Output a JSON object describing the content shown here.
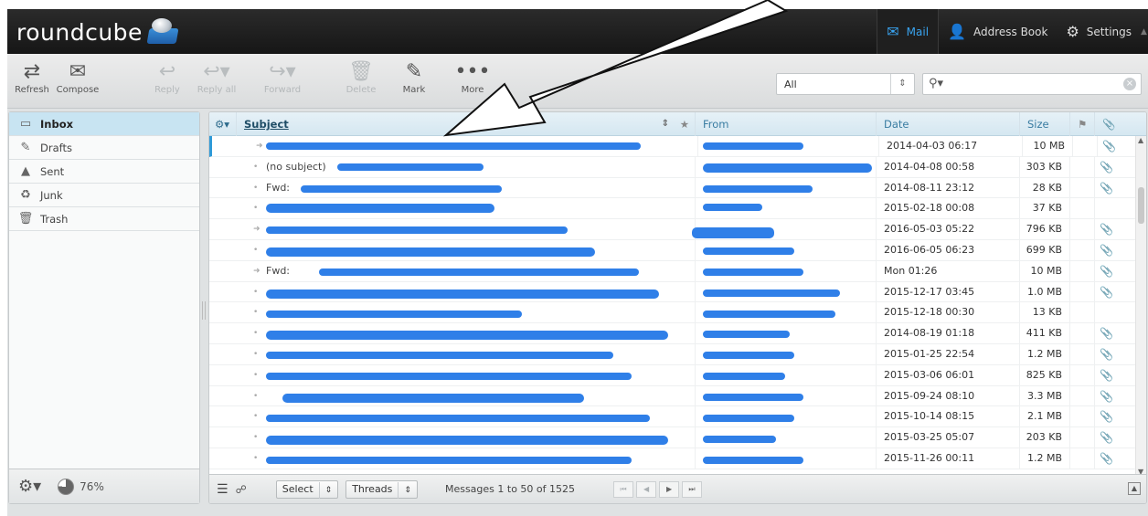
{
  "brand": {
    "name": "roundcube"
  },
  "topnav": [
    {
      "label": "Mail",
      "icon": "envelope-icon"
    },
    {
      "label": "Address Book",
      "icon": "person-icon"
    },
    {
      "label": "Settings",
      "icon": "gear-icon"
    }
  ],
  "toolbar": {
    "refresh": "Refresh",
    "compose": "Compose",
    "reply": "Reply",
    "reply_all": "Reply all",
    "forward": "Forward",
    "delete": "Delete",
    "mark": "Mark",
    "more": "More"
  },
  "filter": {
    "value": "All"
  },
  "search": {
    "placeholder": ""
  },
  "folders": [
    {
      "label": "Inbox",
      "icon": "inbox-icon",
      "active": true
    },
    {
      "label": "Drafts",
      "icon": "pencil-icon"
    },
    {
      "label": "Sent",
      "icon": "sent-icon"
    },
    {
      "label": "Junk",
      "icon": "junk-icon"
    },
    {
      "label": "Trash",
      "icon": "trash-icon"
    }
  ],
  "quota": {
    "label": "76%",
    "fraction": 0.76
  },
  "columns": {
    "subject": "Subject",
    "from": "From",
    "date": "Date",
    "size": "Size"
  },
  "messages": [
    {
      "subject": "",
      "from": "",
      "date": "2014-04-03 06:17",
      "size": "10 MB",
      "attachment": true
    },
    {
      "subject": "(no subject)",
      "from": "",
      "date": "2014-04-08 00:58",
      "size": "303 KB",
      "attachment": true
    },
    {
      "subject": "Fwd:",
      "from": "",
      "date": "2014-08-11 23:12",
      "size": "28 KB",
      "attachment": true
    },
    {
      "subject": "",
      "from": "",
      "date": "2015-02-18 00:08",
      "size": "37 KB",
      "attachment": false
    },
    {
      "subject": "",
      "from": "",
      "date": "2016-05-03 05:22",
      "size": "796 KB",
      "attachment": true
    },
    {
      "subject": "",
      "from": "",
      "date": "2016-06-05 06:23",
      "size": "699 KB",
      "attachment": true
    },
    {
      "subject": "Fwd:",
      "from": "",
      "date": "Mon 01:26",
      "size": "10 MB",
      "attachment": true
    },
    {
      "subject": "",
      "from": "",
      "date": "2015-12-17 03:45",
      "size": "1.0 MB",
      "attachment": true
    },
    {
      "subject": "",
      "from": "",
      "date": "2015-12-18 00:30",
      "size": "13 KB",
      "attachment": false
    },
    {
      "subject": "",
      "from": "",
      "date": "2014-08-19 01:18",
      "size": "411 KB",
      "attachment": true
    },
    {
      "subject": "",
      "from": "",
      "date": "2015-01-25 22:54",
      "size": "1.2 MB",
      "attachment": true
    },
    {
      "subject": "",
      "from": "",
      "date": "2015-03-06 06:01",
      "size": "825 KB",
      "attachment": true
    },
    {
      "subject": "",
      "from": "",
      "date": "2015-09-24 08:10",
      "size": "3.3 MB",
      "attachment": true
    },
    {
      "subject": "",
      "from": "",
      "date": "2015-10-14 08:15",
      "size": "2.1 MB",
      "attachment": true
    },
    {
      "subject": "",
      "from": "",
      "date": "2015-03-25 05:07",
      "size": "203 KB",
      "attachment": true
    },
    {
      "subject": "",
      "from": "",
      "date": "2015-11-26 00:11",
      "size": "1.2 MB",
      "attachment": true
    }
  ],
  "footer": {
    "select": "Select",
    "threads": "Threads",
    "count": "Messages 1 to 50 of 1525"
  },
  "colors": {
    "accent": "#39a4f0",
    "redaction": "#2f7fe8",
    "selected": "#c8e4f2"
  }
}
